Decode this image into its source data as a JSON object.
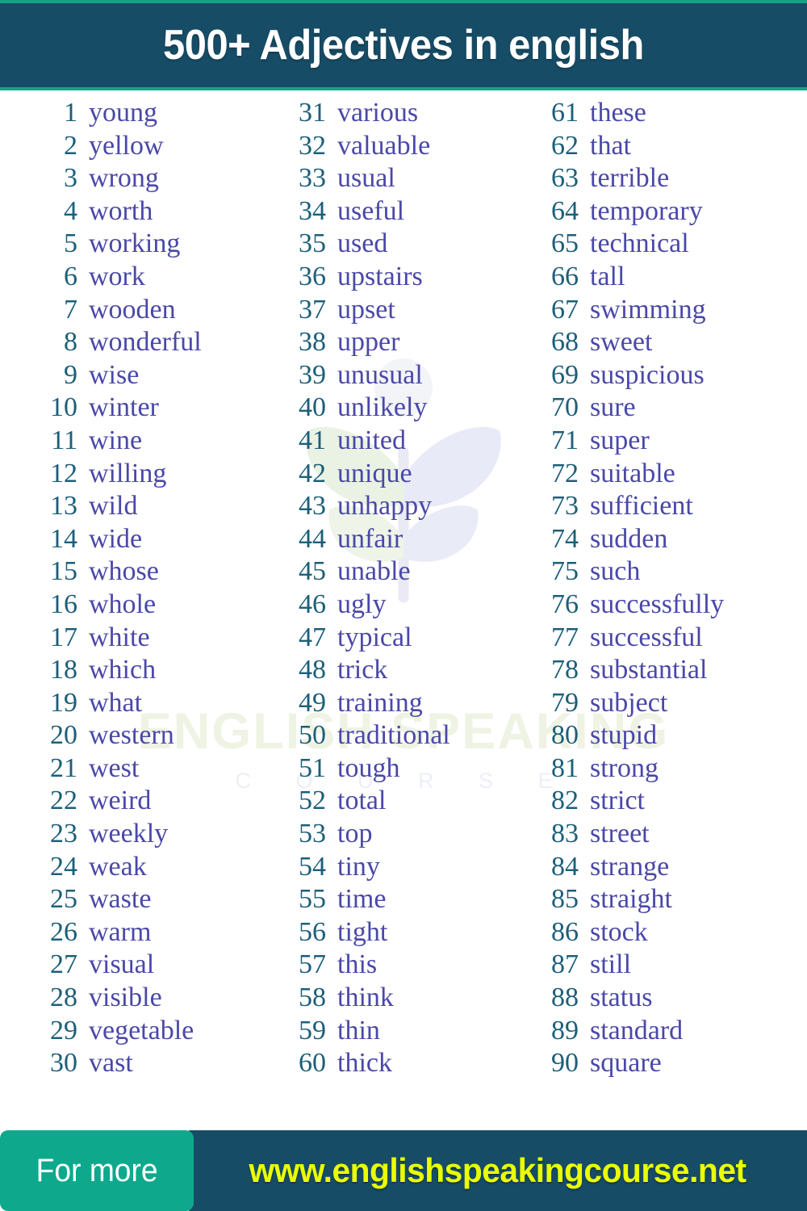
{
  "header": {
    "title": "500+ Adjectives in english",
    "background_color": "#174c66",
    "accent_color": "#12a484",
    "title_color": "#ffffff"
  },
  "theme": {
    "number_color": "#1c5f79",
    "word_color": "#4a48a8",
    "page_background": "#ffffff",
    "green": "#0ea98c",
    "dark_teal": "#174c66",
    "url_yellow": "#eaff00"
  },
  "watermark": {
    "brand_line1": "ENGLISH SPEAKING",
    "brand_line2": "C O U R S E",
    "logo_name": "leaf-plant-logo"
  },
  "columns": [
    {
      "name": "column-1",
      "items": [
        {
          "num": "1",
          "word": "young"
        },
        {
          "num": "2",
          "word": "yellow"
        },
        {
          "num": "3",
          "word": "wrong"
        },
        {
          "num": "4",
          "word": "worth"
        },
        {
          "num": "5",
          "word": "working"
        },
        {
          "num": "6",
          "word": "work"
        },
        {
          "num": "7",
          "word": "wooden"
        },
        {
          "num": "8",
          "word": "wonderful"
        },
        {
          "num": "9",
          "word": "wise"
        },
        {
          "num": "10",
          "word": "winter"
        },
        {
          "num": "11",
          "word": "wine"
        },
        {
          "num": "12",
          "word": "willing"
        },
        {
          "num": "13",
          "word": "wild"
        },
        {
          "num": "14",
          "word": "wide"
        },
        {
          "num": "15",
          "word": "whose"
        },
        {
          "num": "16",
          "word": "whole"
        },
        {
          "num": "17",
          "word": "white"
        },
        {
          "num": "18",
          "word": "which"
        },
        {
          "num": "19",
          "word": "what"
        },
        {
          "num": "20",
          "word": "western"
        },
        {
          "num": "21",
          "word": "west"
        },
        {
          "num": "22",
          "word": "weird"
        },
        {
          "num": "23",
          "word": "weekly"
        },
        {
          "num": "24",
          "word": "weak"
        },
        {
          "num": "25",
          "word": "waste"
        },
        {
          "num": "26",
          "word": "warm"
        },
        {
          "num": "27",
          "word": "visual"
        },
        {
          "num": "28",
          "word": "visible"
        },
        {
          "num": "29",
          "word": "vegetable"
        },
        {
          "num": "30",
          "word": "vast"
        }
      ]
    },
    {
      "name": "column-2",
      "items": [
        {
          "num": "31",
          "word": "various"
        },
        {
          "num": "32",
          "word": "valuable"
        },
        {
          "num": "33",
          "word": "usual"
        },
        {
          "num": "34",
          "word": "useful"
        },
        {
          "num": "35",
          "word": "used"
        },
        {
          "num": "36",
          "word": "upstairs"
        },
        {
          "num": "37",
          "word": "upset"
        },
        {
          "num": "38",
          "word": "upper"
        },
        {
          "num": "39",
          "word": "unusual"
        },
        {
          "num": "40",
          "word": "unlikely"
        },
        {
          "num": "41",
          "word": "united"
        },
        {
          "num": "42",
          "word": "unique"
        },
        {
          "num": "43",
          "word": "unhappy"
        },
        {
          "num": "44",
          "word": "unfair"
        },
        {
          "num": "45",
          "word": "unable"
        },
        {
          "num": "46",
          "word": "ugly"
        },
        {
          "num": "47",
          "word": "typical"
        },
        {
          "num": "48",
          "word": "trick"
        },
        {
          "num": "49",
          "word": "training"
        },
        {
          "num": "50",
          "word": "traditional"
        },
        {
          "num": "51",
          "word": "tough"
        },
        {
          "num": "52",
          "word": "total"
        },
        {
          "num": "53",
          "word": "top"
        },
        {
          "num": "54",
          "word": "tiny"
        },
        {
          "num": "55",
          "word": "time"
        },
        {
          "num": "56",
          "word": "tight"
        },
        {
          "num": "57",
          "word": "this"
        },
        {
          "num": "58",
          "word": "think"
        },
        {
          "num": "59",
          "word": "thin"
        },
        {
          "num": "60",
          "word": "thick"
        }
      ]
    },
    {
      "name": "column-3",
      "items": [
        {
          "num": "61",
          "word": "these"
        },
        {
          "num": "62",
          "word": "that"
        },
        {
          "num": "63",
          "word": "terrible"
        },
        {
          "num": "64",
          "word": "temporary"
        },
        {
          "num": "65",
          "word": "technical"
        },
        {
          "num": "66",
          "word": "tall"
        },
        {
          "num": "67",
          "word": "swimming"
        },
        {
          "num": "68",
          "word": "sweet"
        },
        {
          "num": "69",
          "word": "suspicious"
        },
        {
          "num": "70",
          "word": "sure"
        },
        {
          "num": "71",
          "word": "super"
        },
        {
          "num": "72",
          "word": "suitable"
        },
        {
          "num": "73",
          "word": "sufficient"
        },
        {
          "num": "74",
          "word": "sudden"
        },
        {
          "num": "75",
          "word": "such"
        },
        {
          "num": "76",
          "word": "successfully"
        },
        {
          "num": "77",
          "word": "successful"
        },
        {
          "num": "78",
          "word": "substantial"
        },
        {
          "num": "79",
          "word": "subject"
        },
        {
          "num": "80",
          "word": "stupid"
        },
        {
          "num": "81",
          "word": "strong"
        },
        {
          "num": "82",
          "word": "strict"
        },
        {
          "num": "83",
          "word": "street"
        },
        {
          "num": "84",
          "word": "strange"
        },
        {
          "num": "85",
          "word": "straight"
        },
        {
          "num": "86",
          "word": "stock"
        },
        {
          "num": "87",
          "word": "still"
        },
        {
          "num": "88",
          "word": "status"
        },
        {
          "num": "89",
          "word": "standard"
        },
        {
          "num": "90",
          "word": "square"
        }
      ]
    }
  ],
  "footer": {
    "left_label": "For more",
    "url": "www.englishspeakingcourse.net"
  }
}
